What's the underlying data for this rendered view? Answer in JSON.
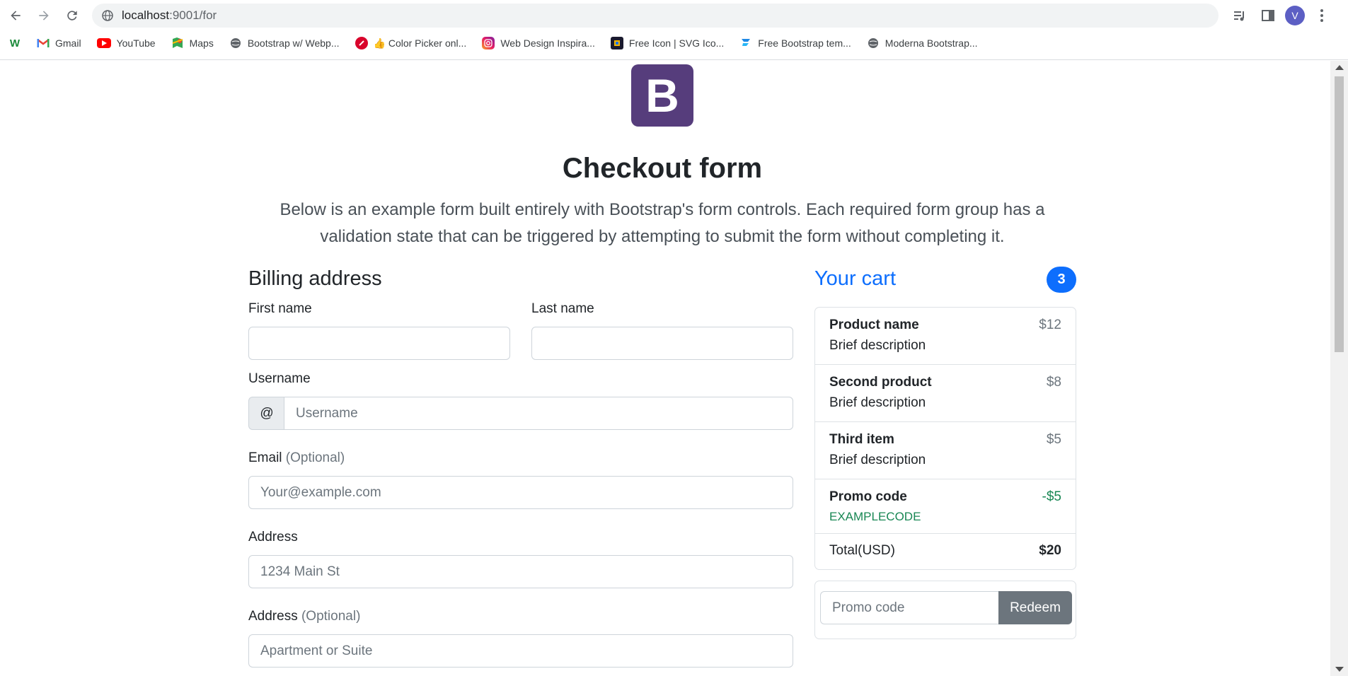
{
  "browser": {
    "url_host": "localhost",
    "url_path": ":9001/for",
    "avatar_letter": "V",
    "bookmarks": [
      {
        "label": "",
        "icon": "w-icon"
      },
      {
        "label": "Gmail",
        "icon": "gmail-icon"
      },
      {
        "label": "YouTube",
        "icon": "youtube-icon"
      },
      {
        "label": "Maps",
        "icon": "maps-icon"
      },
      {
        "label": "Bootstrap w/ Webp...",
        "icon": "globe-icon"
      },
      {
        "label": "👍 Color Picker onl...",
        "icon": "color-picker-icon"
      },
      {
        "label": "Web Design Inspira...",
        "icon": "instagram-icon"
      },
      {
        "label": "Free Icon | SVG Ico...",
        "icon": "icon-site-icon"
      },
      {
        "label": "Free Bootstrap tem...",
        "icon": "bootstrap-template-icon"
      },
      {
        "label": "Moderna Bootstrap...",
        "icon": "globe-icon"
      }
    ]
  },
  "page": {
    "logo_letter": "B",
    "title": "Checkout form",
    "lead": "Below is an example form built entirely with Bootstrap's form controls. Each required form group has a validation state that can be triggered by attempting to submit the form without completing it."
  },
  "billing": {
    "title": "Billing address",
    "first_name_label": "First name",
    "last_name_label": "Last name",
    "username_label": "Username",
    "username_addon": "@",
    "username_placeholder": "Username",
    "email_label": "Email",
    "email_optional": "(Optional)",
    "email_placeholder": "Your@example.com",
    "address_label": "Address",
    "address_placeholder": "1234 Main St",
    "address2_label": "Address",
    "address2_optional": "(Optional)",
    "address2_placeholder": "Apartment or Suite"
  },
  "cart": {
    "title": "Your cart",
    "count": "3",
    "items": [
      {
        "name": "Product name",
        "desc": "Brief description",
        "price": "$12"
      },
      {
        "name": "Second product",
        "desc": "Brief description",
        "price": "$8"
      },
      {
        "name": "Third item",
        "desc": "Brief description",
        "price": "$5"
      }
    ],
    "promo": {
      "name": "Promo code",
      "code": "EXAMPLECODE",
      "amount": "-$5"
    },
    "total_label": "Total(USD)",
    "total_amount": "$20",
    "promo_placeholder": "Promo code",
    "redeem_label": "Redeem"
  },
  "colors": {
    "primary": "#0d6efd",
    "success": "#198754",
    "secondary": "#6c757d",
    "brand": "#563d7c"
  }
}
